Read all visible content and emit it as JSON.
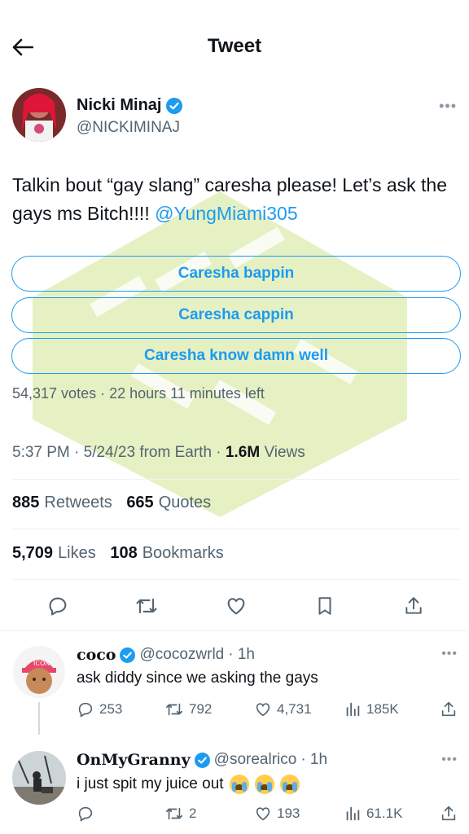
{
  "header": {
    "title": "Tweet"
  },
  "author": {
    "name": "Nicki Minaj",
    "handle": "@NICKIMINAJ"
  },
  "tweet": {
    "text": "Talkin bout “gay slang” caresha please! Let’s ask the gays ms Bitch!!!!",
    "mention": "@YungMiami305"
  },
  "poll": {
    "options": [
      "Caresha bappin",
      "Caresha cappin",
      "Caresha know damn well"
    ],
    "meta": "54,317 votes · 22 hours 11 minutes left"
  },
  "meta": {
    "time": "5:37 PM · 5/24/23 from Earth ·",
    "views_count": "1.6M",
    "views_label": "Views"
  },
  "stats": {
    "retweets_count": "885",
    "retweets_label": "Retweets",
    "quotes_count": "665",
    "quotes_label": "Quotes",
    "likes_count": "5,709",
    "likes_label": "Likes",
    "bookmarks_count": "108",
    "bookmarks_label": "Bookmarks"
  },
  "replies": [
    {
      "name": "coco",
      "handle": "@cocozwrld",
      "time": "· 1h",
      "text": "ask diddy since we asking the gays",
      "replies": "253",
      "retweets": "792",
      "likes": "4,731",
      "views": "185K"
    },
    {
      "name": "OnMyGranny",
      "handle": "@sorealrico",
      "time": "· 1h",
      "text": "i just spit my juice out",
      "replies": "",
      "retweets": "2",
      "likes": "193",
      "views": "61.1K"
    }
  ],
  "colors": {
    "accent": "#1d9bf0",
    "text": "#0f1419",
    "muted": "#536471",
    "watermark": "#c7df7a"
  },
  "icons": [
    "back-arrow-icon",
    "verified-badge-icon",
    "more-icon",
    "reply-icon",
    "retweet-icon",
    "like-icon",
    "bookmark-icon",
    "share-icon",
    "views-icon"
  ]
}
